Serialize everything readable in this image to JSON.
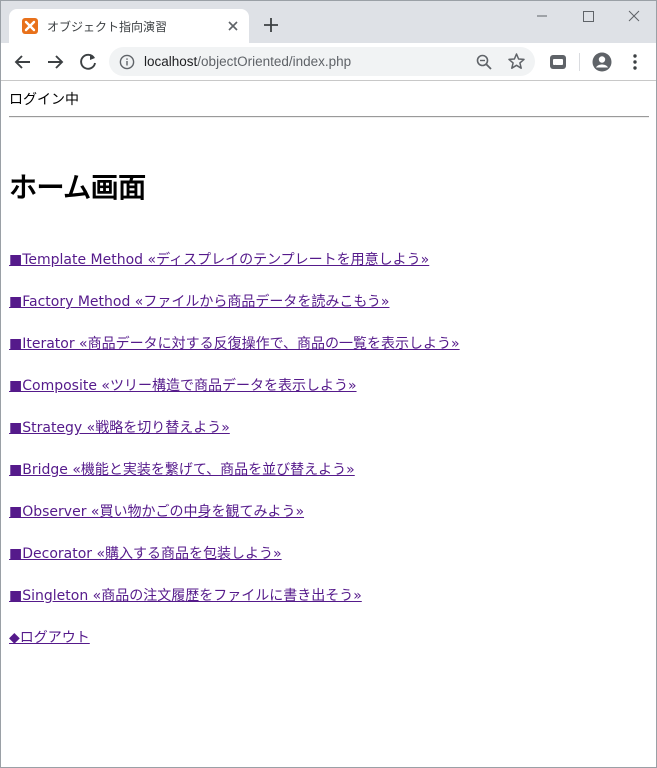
{
  "browser": {
    "tab_title": "オブジェクト指向演習",
    "url_host": "localhost",
    "url_path": "/objectOriented/index.php"
  },
  "page": {
    "status": "ログイン中",
    "heading": "ホーム画面",
    "links": [
      "■Template Method «ディスプレイのテンプレートを用意しよう»",
      "■Factory Method «ファイルから商品データを読みこもう»",
      "■Iterator «商品データに対する反復操作で、商品の一覧を表示しよう»",
      "■Composite «ツリー構造で商品データを表示しよう»",
      "■Strategy «戦略を切り替えよう»",
      "■Bridge «機能と実装を繋げて、商品を並び替えよう»",
      "■Observer «買い物かごの中身を観てみよう»",
      "■Decorator «購入する商品を包装しよう»",
      "■Singleton «商品の注文履歴をファイルに書き出そう»"
    ],
    "logout": "◆ログアウト"
  },
  "colors": {
    "link_visited": "#551a8b",
    "tabstrip": "#dee1e6",
    "favicon": "#e8711b"
  },
  "icons": [
    "xampp-favicon",
    "close-icon",
    "plus-icon",
    "minimize-icon",
    "maximize-icon",
    "window-close-icon",
    "back-arrow-icon",
    "forward-arrow-icon",
    "reload-icon",
    "info-icon",
    "zoom-out-icon",
    "star-icon",
    "extension-icon",
    "profile-icon",
    "kebab-menu-icon"
  ]
}
